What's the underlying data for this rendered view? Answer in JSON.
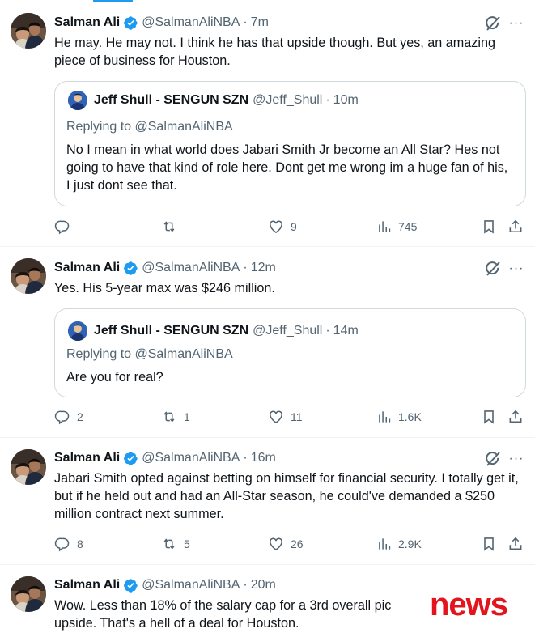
{
  "colors": {
    "accent": "#1d9bf0",
    "text": "#0f1419",
    "muted": "#536471",
    "border": "#cfd9de",
    "news_red": "#e3141c"
  },
  "tweets": [
    {
      "name": "Salman Ali",
      "handle": "@SalmanAliNBA",
      "time": "7m",
      "text": "He may. He may not. I think he has that upside though. But yes, an amazing piece of business for Houston.",
      "quote": {
        "name": "Jeff Shull - SENGUN SZN",
        "handle": "@Jeff_Shull",
        "time": "10m",
        "replying_label": "Replying to",
        "replying_to": "@SalmanAliNBA",
        "text": "No I mean in what world does Jabari Smith Jr become an All Star? Hes not going to have that kind of role here. Dont get me wrong im a huge fan of his, I just dont see that."
      },
      "stats": {
        "replies": "",
        "retweets": "",
        "likes": "9",
        "views": "745"
      }
    },
    {
      "name": "Salman Ali",
      "handle": "@SalmanAliNBA",
      "time": "12m",
      "text": "Yes. His 5-year max was $246 million.",
      "quote": {
        "name": "Jeff Shull - SENGUN SZN",
        "handle": "@Jeff_Shull",
        "time": "14m",
        "replying_label": "Replying to",
        "replying_to": "@SalmanAliNBA",
        "text": "Are you for real?"
      },
      "stats": {
        "replies": "2",
        "retweets": "1",
        "likes": "11",
        "views": "1.6K"
      }
    },
    {
      "name": "Salman Ali",
      "handle": "@SalmanAliNBA",
      "time": "16m",
      "text": "Jabari Smith opted against betting on himself for financial security. I totally get it, but if he held out and had an All-Star season, he could've demanded a $250 million contract next summer.",
      "stats": {
        "replies": "8",
        "retweets": "5",
        "likes": "26",
        "views": "2.9K"
      }
    },
    {
      "name": "Salman Ali",
      "handle": "@SalmanAliNBA",
      "time": "20m",
      "text": "Wow. Less than 18% of the salary cap for a 3rd overall pic",
      "text_line2": "upside. That's a hell of a deal for Houston."
    }
  ],
  "icons": {
    "verified": "verified-badge-icon",
    "grok": "grok-icon",
    "more": "more-icon",
    "reply": "reply-icon",
    "retweet": "retweet-icon",
    "like": "like-icon",
    "views": "views-icon",
    "bookmark": "bookmark-icon",
    "share": "share-icon"
  },
  "more_glyph": "···",
  "dot": "·",
  "watermark": {
    "text": "news"
  }
}
